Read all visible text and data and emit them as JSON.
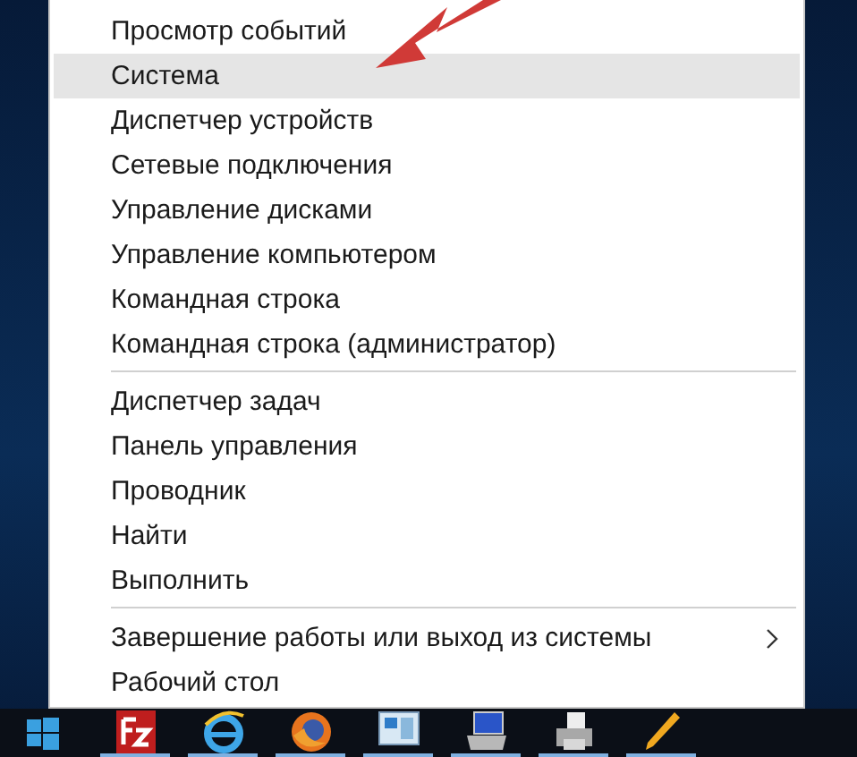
{
  "menu": {
    "groups": [
      {
        "items": [
          {
            "label": "Просмотр событий",
            "selected": false,
            "submenu": false
          },
          {
            "label": "Система",
            "selected": true,
            "submenu": false
          },
          {
            "label": "Диспетчер устройств",
            "selected": false,
            "submenu": false
          },
          {
            "label": "Сетевые подключения",
            "selected": false,
            "submenu": false
          },
          {
            "label": "Управление дисками",
            "selected": false,
            "submenu": false
          },
          {
            "label": "Управление компьютером",
            "selected": false,
            "submenu": false
          },
          {
            "label": "Командная строка",
            "selected": false,
            "submenu": false
          },
          {
            "label": "Командная строка (администратор)",
            "selected": false,
            "submenu": false
          }
        ]
      },
      {
        "items": [
          {
            "label": "Диспетчер задач",
            "selected": false,
            "submenu": false
          },
          {
            "label": "Панель управления",
            "selected": false,
            "submenu": false
          },
          {
            "label": "Проводник",
            "selected": false,
            "submenu": false
          },
          {
            "label": "Найти",
            "selected": false,
            "submenu": false
          },
          {
            "label": "Выполнить",
            "selected": false,
            "submenu": false
          }
        ]
      },
      {
        "items": [
          {
            "label": "Завершение работы или выход из системы",
            "selected": false,
            "submenu": true
          },
          {
            "label": "Рабочий стол",
            "selected": false,
            "submenu": false
          }
        ]
      }
    ]
  },
  "taskbar": {
    "apps": [
      {
        "kind": "ftp",
        "running": true
      },
      {
        "kind": "ie",
        "running": true
      },
      {
        "kind": "firefox",
        "running": true
      },
      {
        "kind": "monitor",
        "running": true
      },
      {
        "kind": "network",
        "running": true
      },
      {
        "kind": "printer",
        "running": true
      },
      {
        "kind": "pencil",
        "running": true
      }
    ]
  }
}
